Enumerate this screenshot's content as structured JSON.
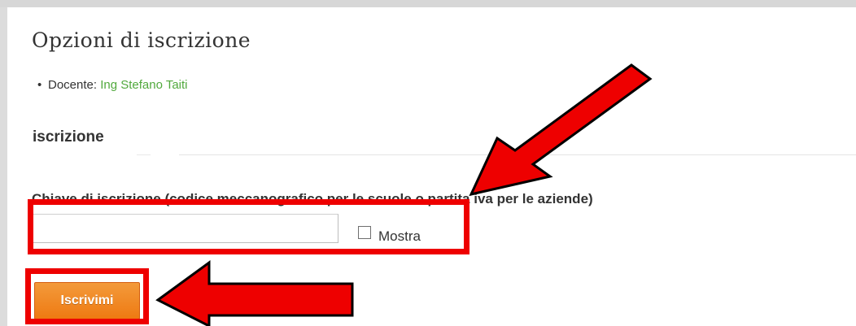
{
  "page": {
    "title": "Opzioni di iscrizione"
  },
  "teacher": {
    "bullet": "•",
    "label": "Docente: ",
    "name": "Ing Stefano Taiti"
  },
  "section": {
    "heading": "iscrizione"
  },
  "enrolment_key": {
    "label": "Chiave di iscrizione (codice meccanografico per le scuole o partita iva per le aziende)",
    "value": "",
    "show_label": "Mostra",
    "show_checked": false
  },
  "button": {
    "label": "Iscrivimi"
  },
  "colors": {
    "highlight": "#ee0000",
    "button": "#ee7a12",
    "link": "#51a93d"
  },
  "icons": {
    "annotation_arrow": "red-arrow"
  }
}
